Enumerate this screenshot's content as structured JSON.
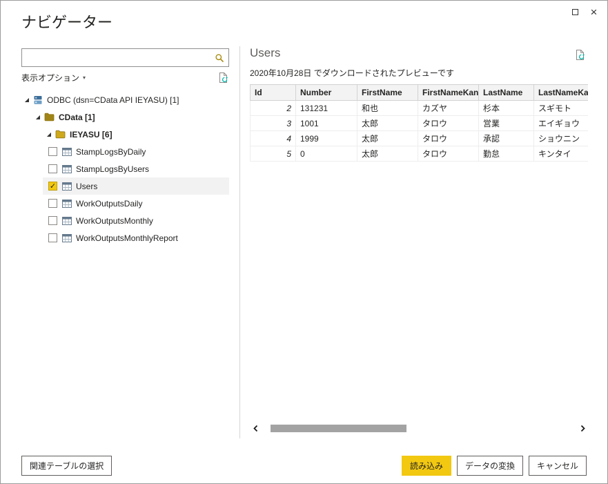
{
  "window": {
    "title": "ナビゲーター"
  },
  "icons": {
    "close": "×",
    "caret": "▾",
    "expanded": "◢",
    "check": "✓"
  },
  "search": {
    "value": ""
  },
  "left_panel": {
    "display_options_label": "表示オプション"
  },
  "tree": {
    "root": {
      "label": "ODBC (dsn=CData API IEYASU) [1]"
    },
    "folders": [
      {
        "label": "CData [1]"
      },
      {
        "label": "IEYASU [6]"
      }
    ],
    "tables": [
      {
        "label": "StampLogsByDaily",
        "checked": false
      },
      {
        "label": "StampLogsByUsers",
        "checked": false
      },
      {
        "label": "Users",
        "checked": true
      },
      {
        "label": "WorkOutputsDaily",
        "checked": false
      },
      {
        "label": "WorkOutputsMonthly",
        "checked": false
      },
      {
        "label": "WorkOutputsMonthlyReport",
        "checked": false
      }
    ]
  },
  "preview": {
    "title": "Users",
    "subtitle": "2020年10月28日 でダウンロードされたプレビューです",
    "table": {
      "columns": [
        "Id",
        "Number",
        "FirstName",
        "FirstNameKana",
        "LastName",
        "LastNameKana"
      ],
      "rows": [
        [
          "2",
          "131231",
          "和也",
          "カズヤ",
          "杉本",
          "スギモト"
        ],
        [
          "3",
          "1001",
          "太郎",
          "タロウ",
          "営業",
          "エイギョウ"
        ],
        [
          "4",
          "1999",
          "太郎",
          "タロウ",
          "承認",
          "ショウニン"
        ],
        [
          "5",
          "0",
          "太郎",
          "タロウ",
          "勤怠",
          "キンタイ"
        ]
      ]
    }
  },
  "footer": {
    "select_related_label": "関連テーブルの選択",
    "load_label": "読み込み",
    "transform_label": "データの変換",
    "cancel_label": "キャンセル"
  },
  "colors": {
    "accent": "#f2c811",
    "refresh_teal": "#01b8aa"
  }
}
